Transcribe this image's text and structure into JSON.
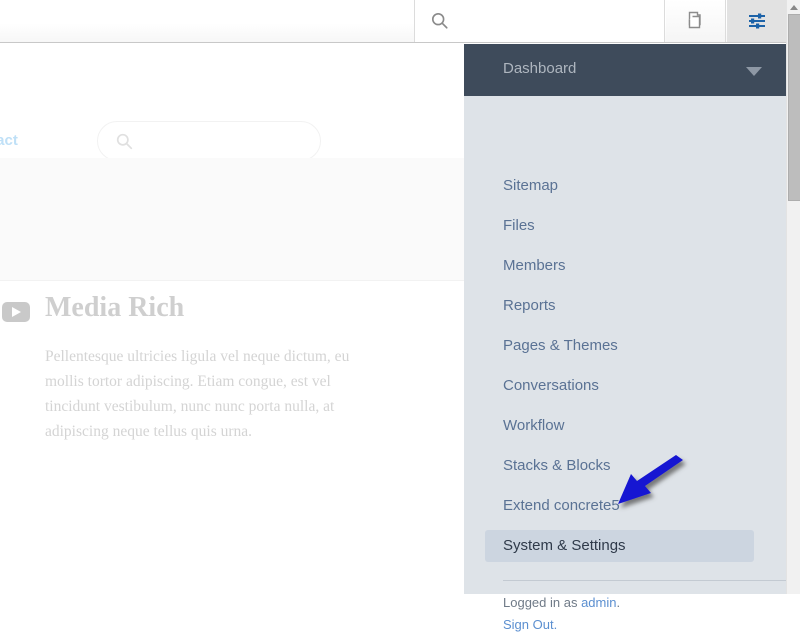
{
  "toolbar": {
    "search_icon": "search-icon",
    "copy_icon": "copy-pages-icon",
    "settings_icon": "sliders-settings-icon"
  },
  "site_page": {
    "nav_link_partial": "ntact",
    "search_placeholder": "",
    "search_value": "",
    "search_icon": "search-icon",
    "media_block": {
      "icon": "play-button-icon",
      "title": "Media Rich",
      "body": "Pellentesque ultricies ligula vel neque dictum, eu mollis tortor adipiscing. Etiam congue, est vel tincidunt vestibulum, nunc nunc porta nulla, at adipiscing neque tellus quis urna."
    }
  },
  "dashboard_panel": {
    "header": {
      "title": "Dashboard",
      "chevron_icon": "chevron-down-icon"
    },
    "menu_items": [
      {
        "label": "Sitemap",
        "active": false
      },
      {
        "label": "Files",
        "active": false
      },
      {
        "label": "Members",
        "active": false
      },
      {
        "label": "Reports",
        "active": false
      },
      {
        "label": "Pages & Themes",
        "active": false
      },
      {
        "label": "Conversations",
        "active": false
      },
      {
        "label": "Workflow",
        "active": false
      },
      {
        "label": "Stacks & Blocks",
        "active": false
      },
      {
        "label": "Extend concrete5",
        "active": false
      },
      {
        "label": "System & Settings",
        "active": true
      }
    ],
    "footer": {
      "logged_in_prefix": "Logged in as ",
      "username": "admin",
      "logged_in_suffix": ".",
      "sign_out": "Sign Out."
    }
  },
  "scrollbar": {
    "up_arrow_icon": "scroll-up-arrow-icon"
  },
  "annotation": {
    "arrow_color": "#1414d2",
    "points_to": "System & Settings"
  },
  "colors": {
    "panel_background": "#dee3e8",
    "panel_header": "#3e4b5b",
    "menu_link": "#5a7294",
    "menu_active_background": "#ccd5e0",
    "menu_active_text": "#2f3a4a",
    "footer_link": "#5b8fd0",
    "toolbar_active": "#e2e2e2",
    "toolbar_icon_blue": "#1d63a8"
  }
}
